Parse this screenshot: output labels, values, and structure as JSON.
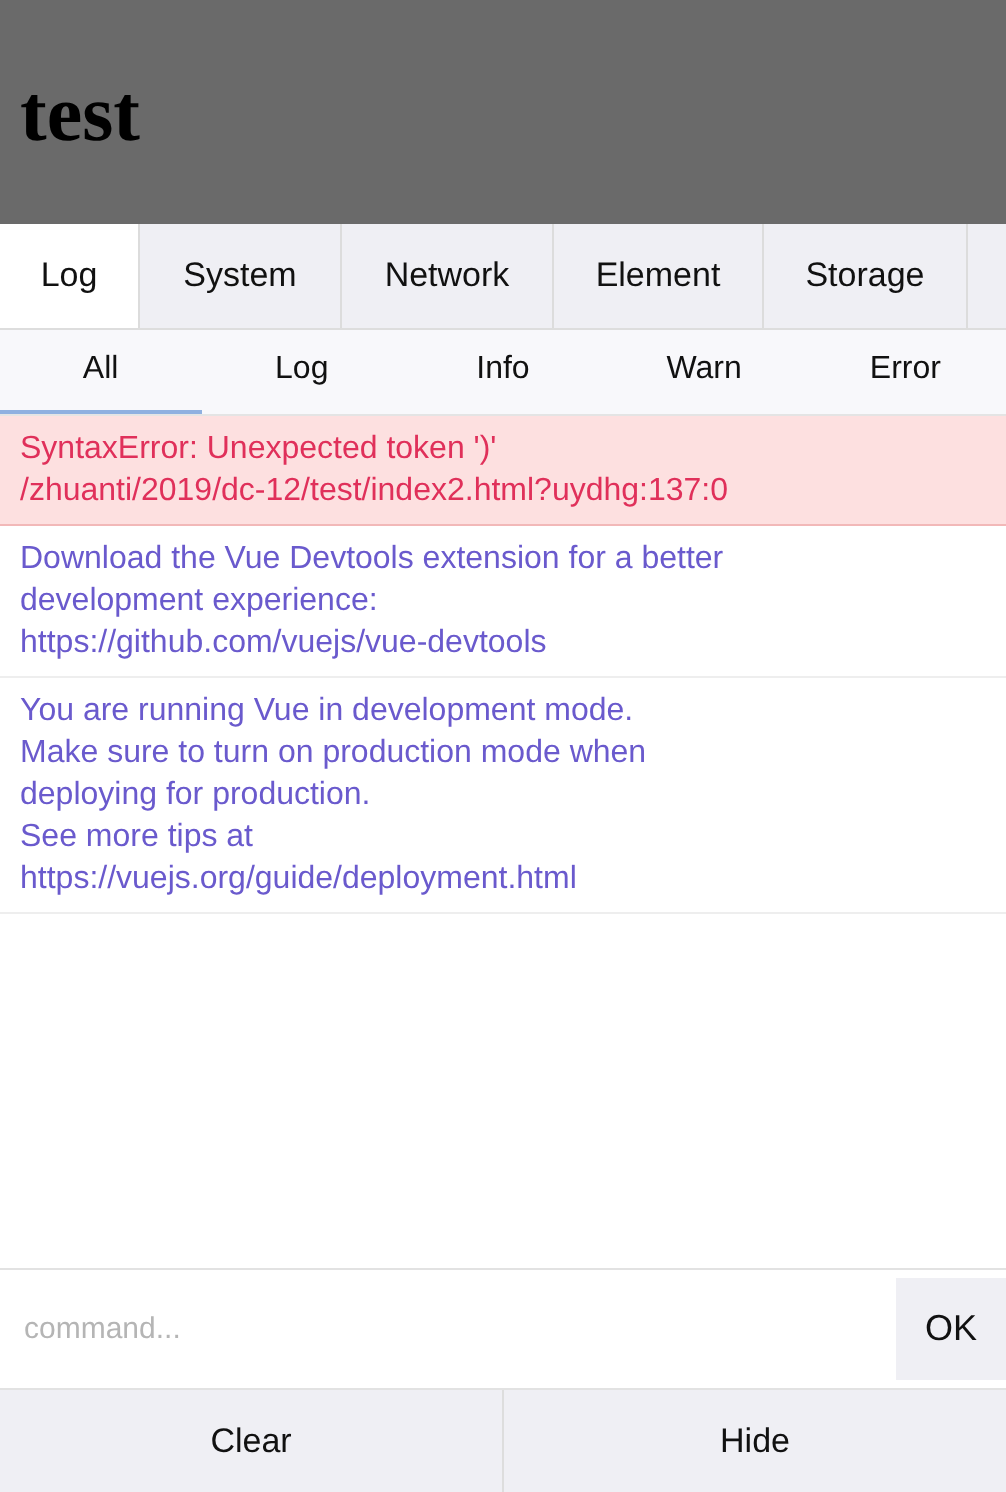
{
  "header": {
    "title": "test"
  },
  "tabs": [
    {
      "label": "Log",
      "selected": true
    },
    {
      "label": "System",
      "selected": false
    },
    {
      "label": "Network",
      "selected": false
    },
    {
      "label": "Element",
      "selected": false
    },
    {
      "label": "Storage",
      "selected": false
    }
  ],
  "filters": [
    {
      "label": "All",
      "selected": true
    },
    {
      "label": "Log",
      "selected": false
    },
    {
      "label": "Info",
      "selected": false
    },
    {
      "label": "Warn",
      "selected": false
    },
    {
      "label": "Error",
      "selected": false
    }
  ],
  "logs": [
    {
      "kind": "error",
      "lines": [
        "SyntaxError: Unexpected token ')'",
        "/zhuanti/2019/dc-12/test/index2.html?uydhg:137:0"
      ]
    },
    {
      "kind": "log",
      "lines": [
        "Download the Vue Devtools extension for a better",
        "development experience:",
        "https://github.com/vuejs/vue-devtools"
      ]
    },
    {
      "kind": "log",
      "lines": [
        "You are running Vue in development mode.",
        "Make sure to turn on production mode when",
        "deploying for production.",
        "See more tips at",
        "https://vuejs.org/guide/deployment.html"
      ]
    }
  ],
  "command": {
    "placeholder": "command...",
    "button": "OK"
  },
  "buttons": [
    "Clear",
    "Hide"
  ]
}
